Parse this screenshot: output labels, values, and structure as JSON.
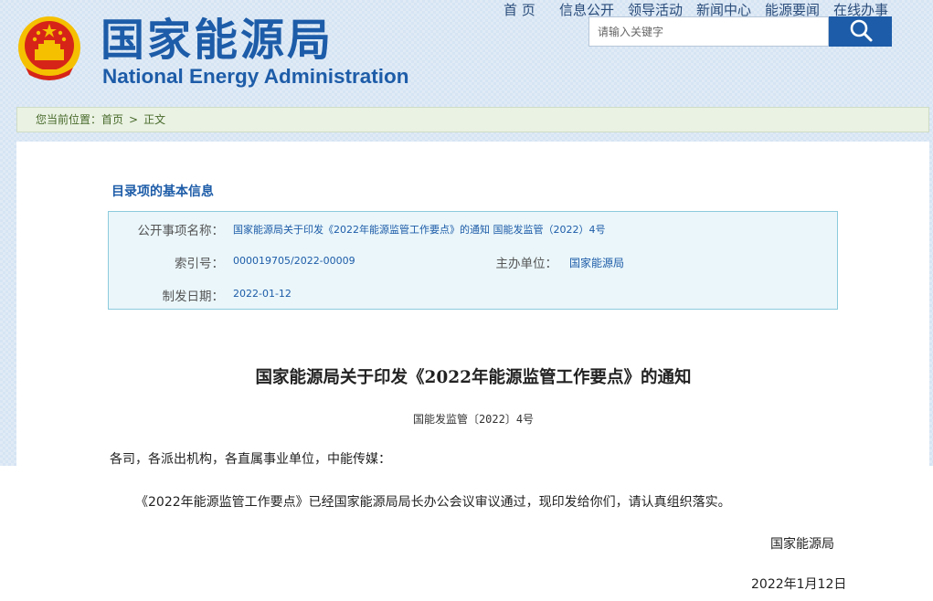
{
  "header": {
    "title_cn": "国家能源局",
    "title_en": "National Energy Administration",
    "search": {
      "placeholder": "请输入关键字"
    },
    "nav": [
      "首 页",
      "信息公开",
      "领导活动",
      "新闻中心",
      "能源要闻",
      "在线办事"
    ]
  },
  "breadcrumb": {
    "prefix": "您当前位置：",
    "home": "首页",
    "separator": ">",
    "current": "正文"
  },
  "info": {
    "section_title": "目录项的基本信息",
    "name_label": "公开事项名称：",
    "name_value": "国家能源局关于印发《2022年能源监管工作要点》的通知 国能发监管（2022）4号",
    "index_label": "索引号：",
    "index_value": "000019705/2022-00009",
    "org_label": "主办单位：",
    "org_value": "国家能源局",
    "date_label": "制发日期：",
    "date_value": "2022-01-12"
  },
  "document": {
    "title": "国家能源局关于印发《2022年能源监管工作要点》的通知",
    "doc_number": "国能发监管〔2022〕4号",
    "salutation": "各司，各派出机构，各直属事业单位，中能传媒：",
    "body": "《2022年能源监管工作要点》已经国家能源局局长办公会议审议通过，现印发给你们，请认真组织落实。",
    "signer": "国家能源局",
    "date": "2022年1月12日"
  },
  "colors": {
    "brand_blue": "#1d5ca8",
    "crumb_green": "#486a2b",
    "info_bg": "#eaf6fa"
  }
}
